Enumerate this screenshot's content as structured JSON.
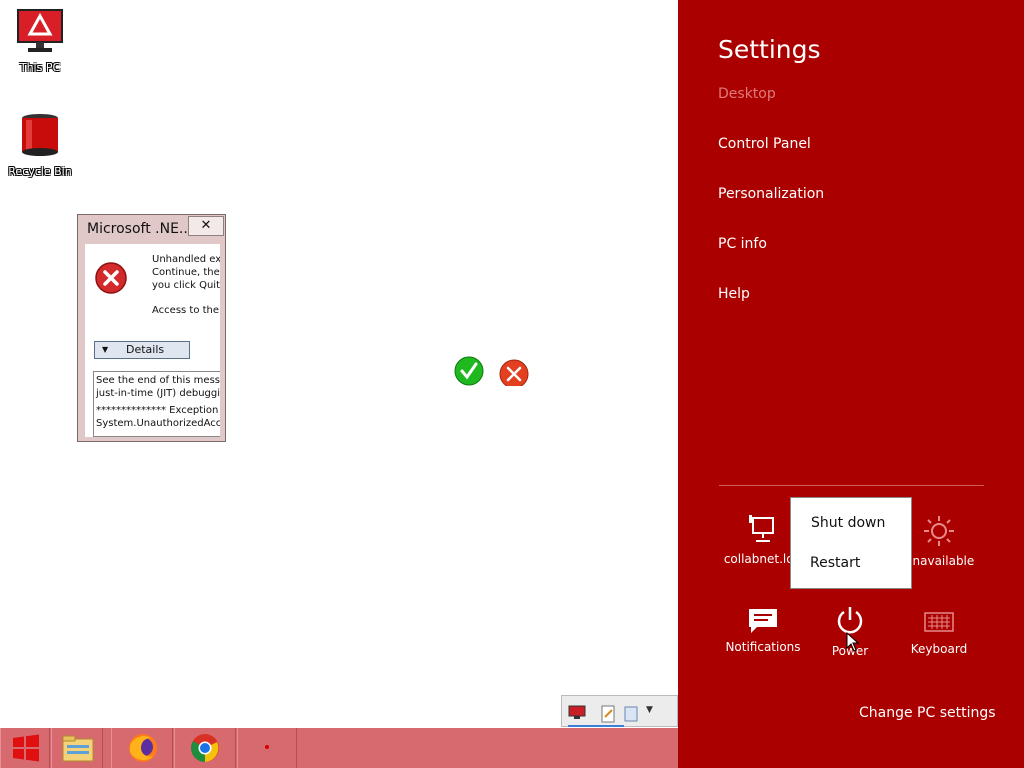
{
  "desktop": {
    "icons": [
      {
        "label": "This PC",
        "icon": "monitor-icon"
      },
      {
        "label": "Recycle Bin",
        "icon": "recycle-bin-icon"
      }
    ]
  },
  "dialog": {
    "title": "Microsoft .NE...",
    "close_label": "✕",
    "message_lines": [
      "Unhandled exc",
      "Continue, the a",
      "you click Quit,"
    ],
    "message2": "Access to the",
    "details_label": "Details",
    "details_text_lines": [
      "See the end of this messag",
      "just-in-time (JIT) debugging",
      "",
      "************** Exception Tex",
      "System.UnauthorizedAcce"
    ]
  },
  "settings": {
    "title": "Settings",
    "links": [
      "Desktop",
      "Control Panel",
      "Personalization",
      "PC info",
      "Help"
    ],
    "tiles": [
      {
        "label": "collabnet.loc",
        "icon": "network-icon"
      },
      {
        "label": "Unavailable",
        "icon": "brightness-icon"
      },
      {
        "label": "Notifications",
        "icon": "notifications-icon"
      },
      {
        "label": "Power",
        "icon": "power-icon"
      },
      {
        "label": "Keyboard",
        "icon": "keyboard-icon"
      }
    ],
    "power_menu": [
      "Shut down",
      "Restart"
    ],
    "change_pc_settings": "Change PC settings"
  },
  "taskbar": {
    "buttons": [
      "start-button",
      "file-explorer",
      "firefox",
      "chrome",
      "app"
    ]
  },
  "colors": {
    "charm_bg": "#ab0000",
    "taskbar_bg": "#d66a6f",
    "dim_link": "#e07a7a"
  }
}
